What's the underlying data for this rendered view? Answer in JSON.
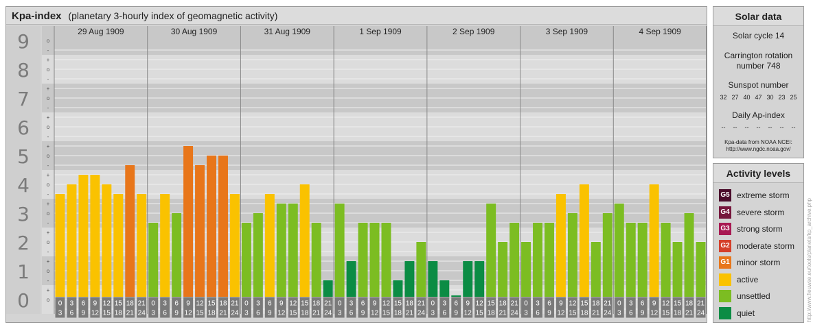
{
  "header": {
    "title": "Kpa-index",
    "subtitle": "(planetary 3-hourly index of geomagnetic activity)"
  },
  "chart_data": {
    "type": "bar",
    "title": "Kpa-index",
    "subtitle": "(planetary 3-hourly index of geomagnetic activity)",
    "ylim": [
      0,
      9
    ],
    "y_ticks": [
      "0",
      "1",
      "2",
      "3",
      "4",
      "5",
      "6",
      "7",
      "8",
      "9"
    ],
    "sub_ticks": [
      "-",
      "o",
      "+"
    ],
    "days": [
      "29 Aug 1909",
      "30 Aug 1909",
      "31 Aug 1909",
      "1 Sep 1909",
      "2 Sep 1909",
      "3 Sep 1909",
      "4 Sep 1909"
    ],
    "interval_start": [
      "0",
      "3",
      "6",
      "9",
      "12",
      "15",
      "18",
      "21"
    ],
    "interval_end": [
      "3",
      "6",
      "9",
      "12",
      "15",
      "18",
      "21",
      "24"
    ],
    "values": [
      3.667,
      4.0,
      4.333,
      4.333,
      4.0,
      3.667,
      4.667,
      3.667,
      2.667,
      3.667,
      3.0,
      5.333,
      4.667,
      5.0,
      5.0,
      3.667,
      2.667,
      3.0,
      3.667,
      3.333,
      3.333,
      4.0,
      2.667,
      0.667,
      3.333,
      1.333,
      2.667,
      2.667,
      2.667,
      0.667,
      1.333,
      2.0,
      1.333,
      0.667,
      0.0,
      1.333,
      1.333,
      3.333,
      2.0,
      2.667,
      2.0,
      2.667,
      2.667,
      3.667,
      3.0,
      4.0,
      2.0,
      3.0,
      3.333,
      2.667,
      2.667,
      4.0,
      2.667,
      2.0,
      3.0,
      2.0
    ],
    "legend_placement": "right",
    "grid": true
  },
  "colors": {
    "quiet": "#0b8c44",
    "unsettled": "#7cbd22",
    "active": "#fac200",
    "minor_storm": "#e8761a",
    "moderate_storm": "#d53f2a",
    "strong_storm": "#a81952",
    "severe_storm": "#76163c",
    "extreme_storm": "#4a0c2b",
    "band_dark": "#c8c8c8",
    "band_light": "#dcdcdc",
    "axis_label": "#7b7b7b",
    "interval_bg": "#7a7a7a"
  },
  "solar": {
    "title": "Solar data",
    "cycle": "Solar cycle 14",
    "rotation_line1": "Carrington rotation",
    "rotation_line2": "number 748",
    "sunspot_label": "Sunspot number",
    "sunspot_values": [
      "32",
      "27",
      "40",
      "47",
      "30",
      "23",
      "25"
    ],
    "ap_label": "Daily Ap-index",
    "ap_values": [
      "--",
      "--",
      "--",
      "--",
      "--",
      "--",
      "--"
    ],
    "source_line1": "Kpa-data from NOAA NCEI:",
    "source_line2": "http://www.ngdc.noaa.gov/"
  },
  "levels": {
    "title": "Activity levels",
    "items": [
      {
        "code": "G5",
        "label": "extreme storm",
        "color": "#4a0c2b"
      },
      {
        "code": "G4",
        "label": "severe storm",
        "color": "#76163c"
      },
      {
        "code": "G3",
        "label": "strong storm",
        "color": "#a81952"
      },
      {
        "code": "G2",
        "label": "moderate storm",
        "color": "#d53f2a"
      },
      {
        "code": "G1",
        "label": "minor storm",
        "color": "#e8761a"
      },
      {
        "code": "",
        "label": "active",
        "color": "#fac200"
      },
      {
        "code": "",
        "label": "unsettled",
        "color": "#7cbd22"
      },
      {
        "code": "",
        "label": "quiet",
        "color": "#0b8c44"
      }
    ]
  },
  "watermark": "http://www.fieuwse.eu/tools/planets/kp_archive.php"
}
